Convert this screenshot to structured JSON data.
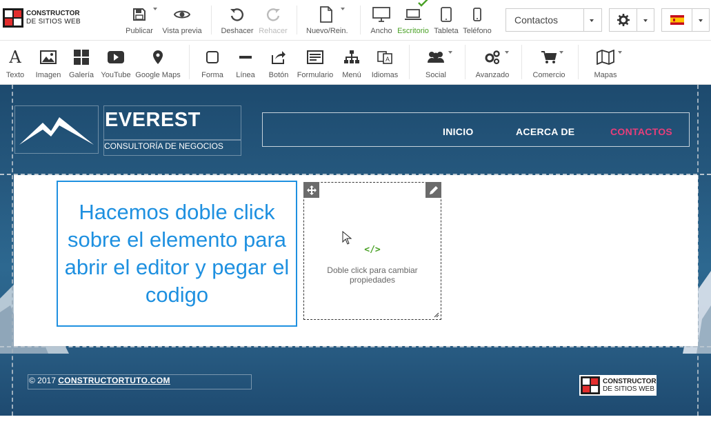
{
  "app": {
    "logo_line1": "CONSTRUCTOR",
    "logo_line2": "DE SITIOS WEB"
  },
  "top_toolbar": {
    "publish": "Publicar",
    "preview": "Vista previa",
    "undo": "Deshacer",
    "redo": "Rehacer",
    "new_reset": "Nuevo/Rein.",
    "wide": "Ancho",
    "desktop": "Escritorio",
    "tablet": "Tableta",
    "phone": "Teléfono",
    "page_select_value": "Contactos",
    "active_device": "Escritorio"
  },
  "insert_toolbar": {
    "items": [
      "Texto",
      "Imagen",
      "Galería",
      "YouTube",
      "Google Maps",
      "Forma",
      "Línea",
      "Botón",
      "Formulario",
      "Menú",
      "Idiomas",
      "Social",
      "Avanzado",
      "Comercio",
      "Mapas"
    ]
  },
  "site": {
    "brand_title": "EVEREST",
    "brand_subtitle": "CONSULTORÍA DE NEGOCIOS",
    "nav": [
      "INICIO",
      "ACERCA DE",
      "CONTACTOS"
    ],
    "nav_active": "CONTACTOS",
    "note_text": "Hacemos doble click sobre el elemento para abrir el editor y pegar el codigo",
    "embed_icon": "</>",
    "embed_hint": "Doble click para cambiar propiedades",
    "footer_prefix": "© 2017",
    "footer_link": "CONSTRUCTORTUTO.COM",
    "footer_logo_line1": "CONSTRUCTOR",
    "footer_logo_line2": "DE SITIOS WEB"
  },
  "colors": {
    "accent_green": "#4aa126",
    "nav_active": "#e83e7a",
    "note_blue": "#1e90e0",
    "canvas_bg": "#26597f"
  }
}
